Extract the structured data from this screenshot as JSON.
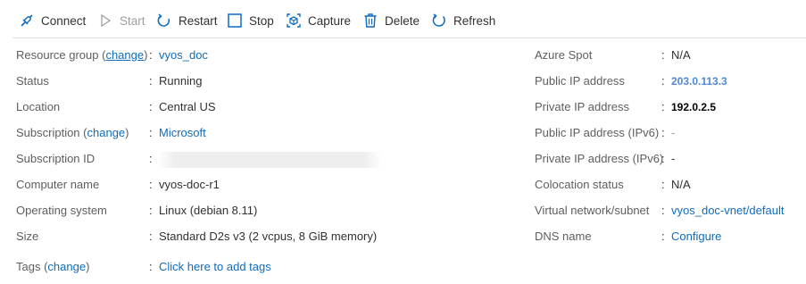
{
  "toolbar": {
    "connect": "Connect",
    "start": "Start",
    "restart": "Restart",
    "stop": "Stop",
    "capture": "Capture",
    "delete": "Delete",
    "refresh": "Refresh"
  },
  "left": {
    "resource_group": {
      "label": "Resource group",
      "change": "change",
      "value": "vyos_doc"
    },
    "status": {
      "label": "Status",
      "value": "Running"
    },
    "location": {
      "label": "Location",
      "value": "Central US"
    },
    "subscription": {
      "label": "Subscription",
      "change": "change",
      "value": "Microsoft"
    },
    "subscription_id": {
      "label": "Subscription ID"
    },
    "computer_name": {
      "label": "Computer name",
      "value": "vyos-doc-r1"
    },
    "os": {
      "label": "Operating system",
      "value": "Linux (debian 8.11)"
    },
    "size": {
      "label": "Size",
      "value": "Standard D2s v3 (2 vcpus, 8 GiB memory)"
    },
    "tags": {
      "label": "Tags",
      "change": "change",
      "value": "Click here to add tags"
    }
  },
  "right": {
    "azure_spot": {
      "label": "Azure Spot",
      "value": "N/A"
    },
    "public_ip": {
      "label": "Public IP address",
      "value": "203.0.113.3"
    },
    "private_ip": {
      "label": "Private IP address",
      "value": "192.0.2.5"
    },
    "public_ipv6": {
      "label": "Public IP address (IPv6)",
      "value": "-"
    },
    "private_ipv6": {
      "label": "Private IP address (IPv6)",
      "value": "-"
    },
    "colocation": {
      "label": "Colocation status",
      "value": "N/A"
    },
    "vnet": {
      "label": "Virtual network/subnet",
      "value": "vyos_doc-vnet/default"
    },
    "dns": {
      "label": "DNS name",
      "value": "Configure"
    }
  },
  "colors": {
    "link": "#0f6cbd",
    "accent": "#0f6cbd",
    "ip_link": "#4f88d4",
    "disabled": "#a19f9d"
  },
  "icons": [
    "connect-icon",
    "play-icon",
    "restart-icon",
    "stop-icon",
    "capture-icon",
    "delete-icon",
    "refresh-icon"
  ]
}
